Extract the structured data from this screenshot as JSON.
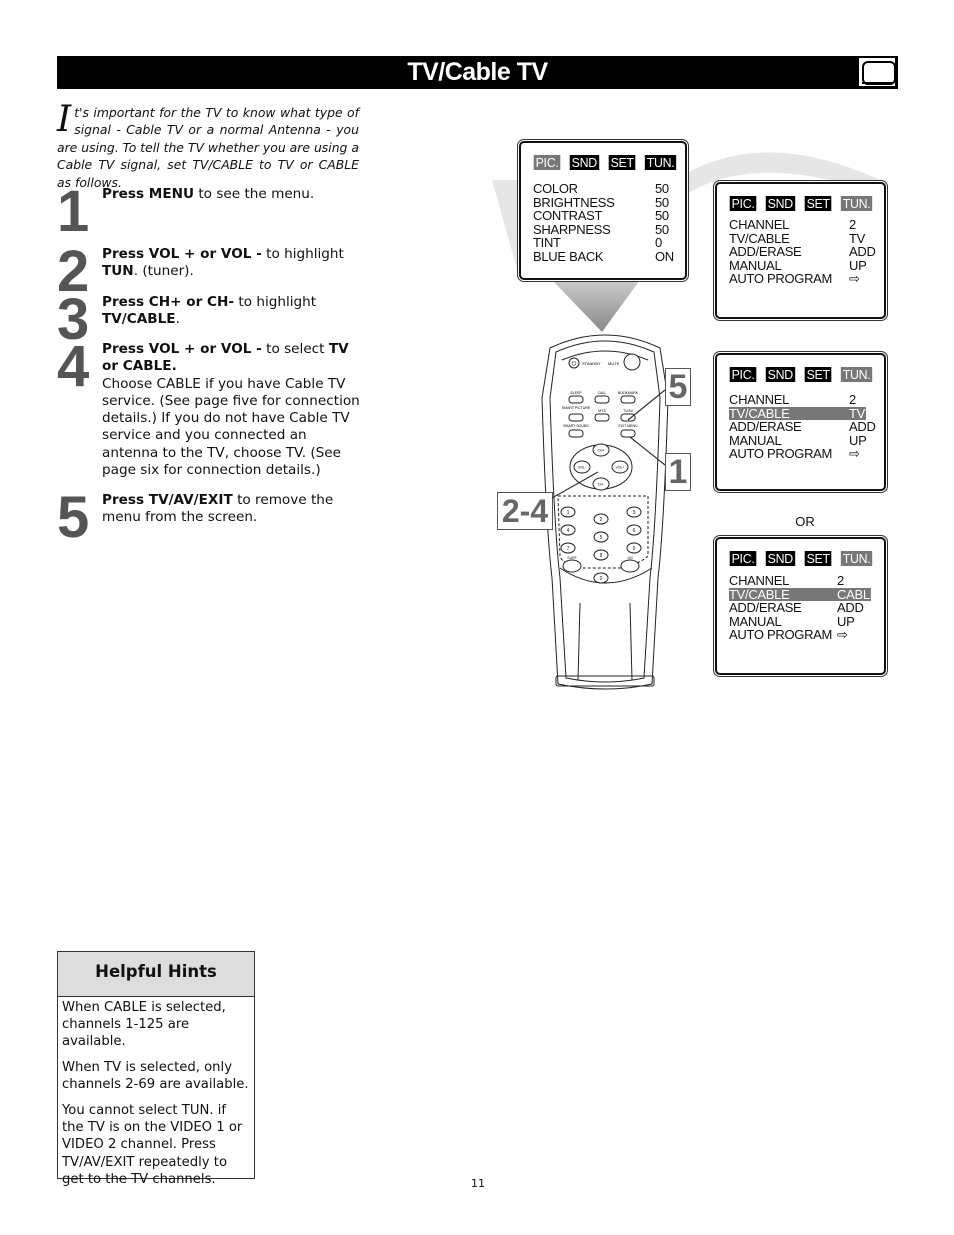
{
  "header": {
    "title": "TV/Cable TV",
    "icon": "tv-screen-icon"
  },
  "intro": {
    "dropcap": "I",
    "text": "t's important for the TV to know what type of signal - Cable TV or a normal Antenna - you are using. To tell the TV whether you are using a Cable TV signal, set TV/CABLE to TV or CABLE as follows."
  },
  "steps": [
    {
      "number": "1",
      "bold": "Press MENU",
      "text": " to see the menu."
    },
    {
      "number": "2",
      "bold": "Press VOL + or VOL -",
      "text": " to highlight ",
      "bold2": "TUN",
      "text2": ". (tuner)."
    },
    {
      "number": "3",
      "bold": "Press CH+ or CH-",
      "text": " to highlight ",
      "bold2": "TV/CABLE",
      "text2": "."
    },
    {
      "number": "4",
      "bold": "Press VOL + or VOL -",
      "text": " to select ",
      "bold2": "TV or CABLE.",
      "text2": "Choose CABLE if you have Cable TV service. (See page five for connection details.) If you do not have Cable TV service and you connected an antenna to the TV, choose TV. (See page six for connection details.)"
    },
    {
      "number": "5",
      "bold": "Press TV/AV/EXIT",
      "text": " to remove the menu from the screen."
    }
  ],
  "menus": {
    "tabs": [
      "PIC.",
      "SND",
      "SET",
      "TUN."
    ],
    "picture_menu": {
      "active_tab": "PIC.",
      "rows": [
        {
          "label": "COLOR",
          "value": "50"
        },
        {
          "label": "BRIGHTNESS",
          "value": "50"
        },
        {
          "label": "CONTRAST",
          "value": "50"
        },
        {
          "label": "SHARPNESS",
          "value": "50"
        },
        {
          "label": "TINT",
          "value": "0"
        },
        {
          "label": "BLUE BACK",
          "value": "ON"
        }
      ]
    },
    "tuner_menu_1": {
      "active_tab": "TUN.",
      "rows": [
        {
          "label": "CHANNEL",
          "value": "2"
        },
        {
          "label": "TV/CABLE",
          "value": "TV"
        },
        {
          "label": "ADD/ERASE",
          "value": "ADD"
        },
        {
          "label": "MANUAL",
          "value": "UP"
        },
        {
          "label": "AUTO PROGRAM",
          "value": "⇨"
        }
      ]
    },
    "tuner_menu_2": {
      "active_tab": "TUN.",
      "highlighted_row": "TV/CABLE",
      "rows": [
        {
          "label": "CHANNEL",
          "value": "2"
        },
        {
          "label": "TV/CABLE",
          "value": "TV"
        },
        {
          "label": "ADD/ERASE",
          "value": "ADD"
        },
        {
          "label": "MANUAL",
          "value": "UP"
        },
        {
          "label": "AUTO PROGRAM",
          "value": "⇨"
        }
      ]
    },
    "or_label": "OR",
    "tuner_menu_3": {
      "active_tab": "TUN.",
      "highlighted_row": "TV/CABLE",
      "rows": [
        {
          "label": "CHANNEL",
          "value": "2"
        },
        {
          "label": "TV/CABLE",
          "value": "CABLE"
        },
        {
          "label": "ADD/ERASE",
          "value": "ADD"
        },
        {
          "label": "MANUAL",
          "value": "UP"
        },
        {
          "label": "AUTO PROGRAM",
          "value": "⇨"
        }
      ]
    }
  },
  "remote": {
    "top_buttons": [
      "STANDBY",
      "MUTE"
    ],
    "function_buttons": [
      "SLEEP",
      "CALL",
      "BOOKMARK",
      "SMART PICTURE",
      "MTS",
      "TV/AV",
      "SMART SOUND",
      "EXIT MENU"
    ],
    "dpad": [
      "CH+",
      "VOL-",
      "VOL+",
      "CH-"
    ],
    "number_keys": [
      "1",
      "2",
      "3",
      "4",
      "5",
      "6",
      "7",
      "8",
      "9",
      "0"
    ],
    "extra_keys": [
      "SURF",
      "100"
    ],
    "callouts": [
      "5",
      "1",
      "2-4"
    ]
  },
  "hints": {
    "title": "Helpful Hints",
    "items": [
      "When CABLE is selected, channels 1-125 are available.",
      "When TV is selected, only channels 2-69 are available.",
      "You cannot select TUN. if the TV is on the VIDEO 1 or VIDEO 2 channel. Press TV/AV/EXIT repeatedly to get to the TV channels."
    ]
  },
  "page_number": "11"
}
